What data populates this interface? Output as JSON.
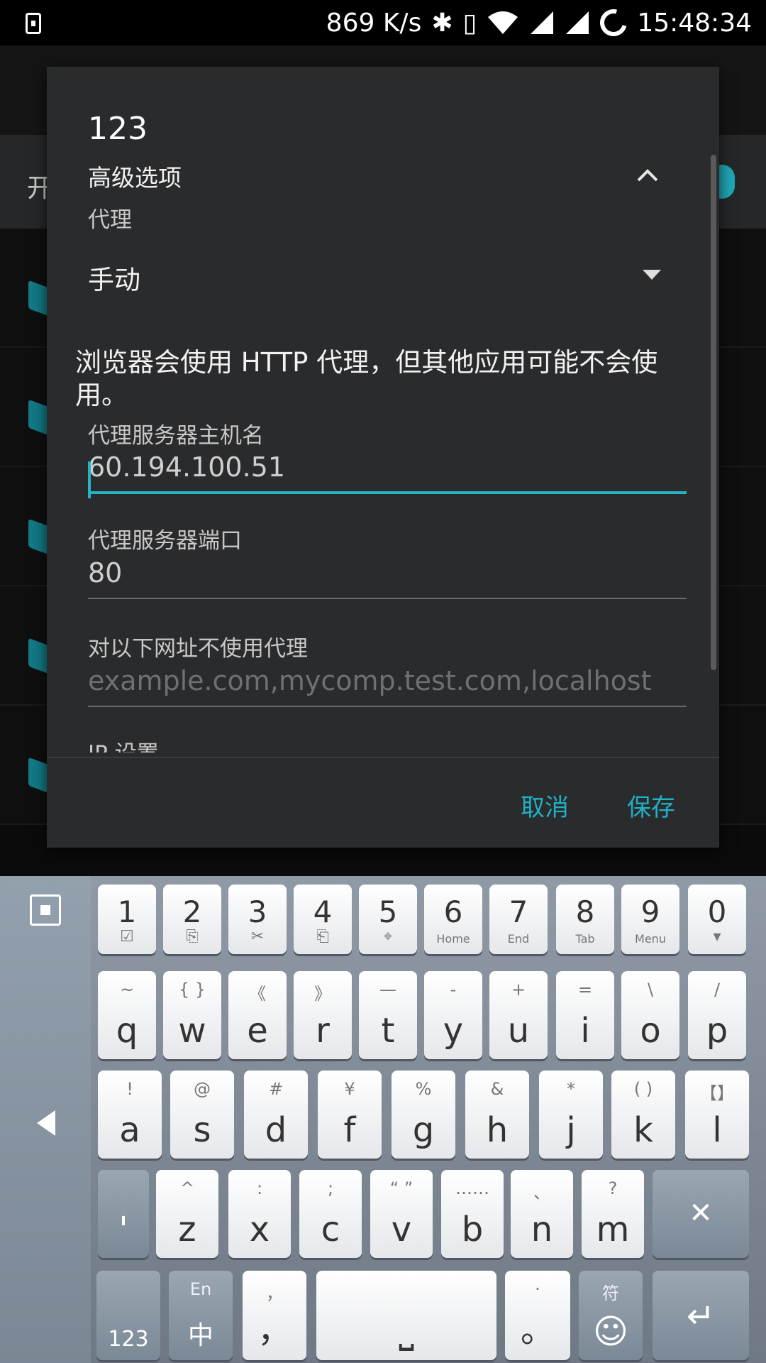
{
  "status_bar": {
    "speed": "869 K/s",
    "time": "15:48:34"
  },
  "background": {
    "switch_label_fragment": "开"
  },
  "dialog": {
    "title": "123",
    "advanced_label": "高级选项",
    "proxy_label": "代理",
    "proxy_value": "手动",
    "note": "浏览器会使用 HTTP 代理，但其他应用可能不会使用。",
    "host_label": "代理服务器主机名",
    "host_value": "60.194.100.51",
    "port_label": "代理服务器端口",
    "port_value": "80",
    "bypass_label": "对以下网址不使用代理",
    "bypass_placeholder": "example.com,mycomp.test.com,localhost",
    "ip_label": "IP 设置",
    "cancel": "取消",
    "save": "保存"
  },
  "keyboard": {
    "number_row": [
      {
        "main": "1",
        "sub": "☑"
      },
      {
        "main": "2",
        "sub": "⎘"
      },
      {
        "main": "3",
        "sub": "✂"
      },
      {
        "main": "4",
        "sub": "⎗"
      },
      {
        "main": "5",
        "sub": "⌖"
      },
      {
        "main": "6",
        "sub": "Home"
      },
      {
        "main": "7",
        "sub": "End"
      },
      {
        "main": "8",
        "sub": "Tab"
      },
      {
        "main": "9",
        "sub": "Menu"
      },
      {
        "main": "0",
        "sub": "▾"
      }
    ],
    "row_q": [
      {
        "main": "q",
        "sub": "~"
      },
      {
        "main": "w",
        "sub": "{ }"
      },
      {
        "main": "e",
        "sub": "《"
      },
      {
        "main": "r",
        "sub": "》"
      },
      {
        "main": "t",
        "sub": "—"
      },
      {
        "main": "y",
        "sub": "-"
      },
      {
        "main": "u",
        "sub": "+"
      },
      {
        "main": "i",
        "sub": "="
      },
      {
        "main": "o",
        "sub": "\\"
      },
      {
        "main": "p",
        "sub": "/"
      }
    ],
    "row_a": [
      {
        "main": "a",
        "sub": "!"
      },
      {
        "main": "s",
        "sub": "@"
      },
      {
        "main": "d",
        "sub": "#"
      },
      {
        "main": "f",
        "sub": "¥"
      },
      {
        "main": "g",
        "sub": "%"
      },
      {
        "main": "h",
        "sub": "&"
      },
      {
        "main": "j",
        "sub": "*"
      },
      {
        "main": "k",
        "sub": "( )"
      },
      {
        "main": "l",
        "sub": "【】"
      }
    ],
    "row_z": [
      {
        "main": "z",
        "sub": "^"
      },
      {
        "main": "x",
        "sub": ":"
      },
      {
        "main": "c",
        "sub": ";"
      },
      {
        "main": "v",
        "sub": "“ ”"
      },
      {
        "main": "b",
        "sub": "……"
      },
      {
        "main": "n",
        "sub": "、"
      },
      {
        "main": "m",
        "sub": "?"
      }
    ],
    "apostrophe": "'",
    "backspace": "✕",
    "key_123": "123",
    "lang_top": "En",
    "lang_bottom": "中",
    "comma_top": "，",
    "comma_bottom": "，",
    "period_top": "·",
    "period_bottom": "。",
    "emoji_top": "符",
    "emoji_icon": "☺",
    "enter": "↵"
  }
}
